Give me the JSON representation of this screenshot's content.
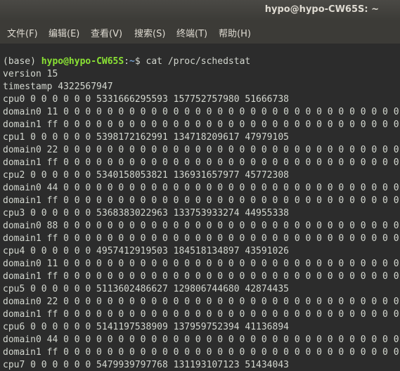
{
  "window": {
    "title": "hypo@hypo-CW65S: ~"
  },
  "menu": [
    "文件(F)",
    "编辑(E)",
    "查看(V)",
    "搜索(S)",
    "终端(T)",
    "帮助(H)"
  ],
  "prompt": {
    "env": "(base) ",
    "user_host": "hypo@hypo-CW65S",
    "sep": ":",
    "path": "~",
    "symbol": "$ ",
    "command": "cat /proc/schedstat"
  },
  "output": [
    "version 15",
    "timestamp 4322567947",
    "cpu0 0 0 0 0 0 0 5331666295593 157752757980 51666738",
    "domain0 11 0 0 0 0 0 0 0 0 0 0 0 0 0 0 0 0 0 0 0 0 0 0 0 0 0 0 0 0 0 0 0 0 0 0 0 0 0",
    "domain1 ff 0 0 0 0 0 0 0 0 0 0 0 0 0 0 0 0 0 0 0 0 0 0 0 0 0 0 0 0 0 0 0 0 0 0 0 0 0",
    "cpu1 0 0 0 0 0 0 5398172162991 134718209617 47979105",
    "domain0 22 0 0 0 0 0 0 0 0 0 0 0 0 0 0 0 0 0 0 0 0 0 0 0 0 0 0 0 0 0 0 0 0 0 0 0 0 0",
    "domain1 ff 0 0 0 0 0 0 0 0 0 0 0 0 0 0 0 0 0 0 0 0 0 0 0 0 0 0 0 0 0 0 0 0 0 0 0 0 0",
    "cpu2 0 0 0 0 0 0 5340158053821 136931657977 45772308",
    "domain0 44 0 0 0 0 0 0 0 0 0 0 0 0 0 0 0 0 0 0 0 0 0 0 0 0 0 0 0 0 0 0 0 0 0 0 0 0 0",
    "domain1 ff 0 0 0 0 0 0 0 0 0 0 0 0 0 0 0 0 0 0 0 0 0 0 0 0 0 0 0 0 0 0 0 0 0 0 0 0 0",
    "cpu3 0 0 0 0 0 0 5368383022963 133753933274 44955338",
    "domain0 88 0 0 0 0 0 0 0 0 0 0 0 0 0 0 0 0 0 0 0 0 0 0 0 0 0 0 0 0 0 0 0 0 0 0 0 0 0",
    "domain1 ff 0 0 0 0 0 0 0 0 0 0 0 0 0 0 0 0 0 0 0 0 0 0 0 0 0 0 0 0 0 0 0 0 0 0 0 0 0",
    "cpu4 0 0 0 0 0 0 4957412919503 184518134897 43591026",
    "domain0 11 0 0 0 0 0 0 0 0 0 0 0 0 0 0 0 0 0 0 0 0 0 0 0 0 0 0 0 0 0 0 0 0 0 0 0 0 0",
    "domain1 ff 0 0 0 0 0 0 0 0 0 0 0 0 0 0 0 0 0 0 0 0 0 0 0 0 0 0 0 0 0 0 0 0 0 0 0 0 0",
    "cpu5 0 0 0 0 0 0 5113602486627 129806744680 42874435",
    "domain0 22 0 0 0 0 0 0 0 0 0 0 0 0 0 0 0 0 0 0 0 0 0 0 0 0 0 0 0 0 0 0 0 0 0 0 0 0 0",
    "domain1 ff 0 0 0 0 0 0 0 0 0 0 0 0 0 0 0 0 0 0 0 0 0 0 0 0 0 0 0 0 0 0 0 0 0 0 0 0 0",
    "cpu6 0 0 0 0 0 0 5141197538909 137959752394 41136894",
    "domain0 44 0 0 0 0 0 0 0 0 0 0 0 0 0 0 0 0 0 0 0 0 0 0 0 0 0 0 0 0 0 0 0 0 0 0 0 0 0",
    "domain1 ff 0 0 0 0 0 0 0 0 0 0 0 0 0 0 0 0 0 0 0 0 0 0 0 0 0 0 0 0 0 0 0 0 0 0 0 0 0",
    "cpu7 0 0 0 0 0 0 5479939797768 131193107123 51434043"
  ]
}
